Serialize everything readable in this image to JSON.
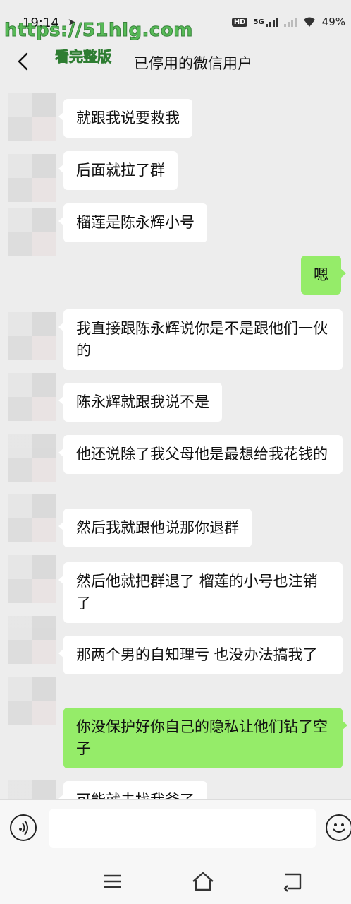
{
  "status": {
    "time": "19:14",
    "network": "5G",
    "hd": "HD",
    "battery": "49%"
  },
  "watermark": {
    "url": "https://51hlg.com",
    "subtitle": "看完整版"
  },
  "header": {
    "title": "已停用的微信用户"
  },
  "messages": [
    {
      "side": "left",
      "text": "就跟我说要救我"
    },
    {
      "side": "left",
      "text": "后面就拉了群"
    },
    {
      "side": "left",
      "text": "榴莲是陈永辉小号"
    },
    {
      "side": "right",
      "text": "嗯"
    },
    {
      "side": "left",
      "text": "我直接跟陈永辉说你是不是跟他们一伙的"
    },
    {
      "side": "left",
      "text": "陈永辉就跟我说不是"
    },
    {
      "side": "left",
      "text": "他还说除了我父母他是最想给我花钱的"
    },
    {
      "side": "left",
      "text": "然后我就跟他说那你退群"
    },
    {
      "side": "left",
      "text": "然后他就把群退了 榴莲的小号也注销了"
    },
    {
      "side": "left",
      "text": "那两个男的自知理亏 也没办法搞我了"
    },
    {
      "side": "right",
      "text": "你没保护好你自己的隐私让他们钻了空子"
    },
    {
      "side": "left",
      "text": "可能就去找我爸了"
    }
  ],
  "input": {
    "value": ""
  },
  "icons": {
    "back": "back-arrow-icon",
    "voice": "voice-icon",
    "emoji": "emoji-icon",
    "menu": "menu-icon",
    "home": "home-icon",
    "return": "return-icon"
  }
}
